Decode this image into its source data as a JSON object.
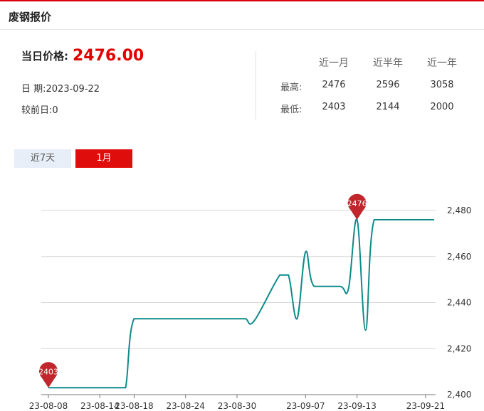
{
  "header": {
    "title": "废钢报价"
  },
  "current": {
    "price_label": "当日价格:",
    "price_value": "2476.00",
    "date_label": "日 期:",
    "date_value": "2023-09-22",
    "change_label": "较前日:",
    "change_value": "0"
  },
  "stats": {
    "columns": [
      "近一月",
      "近半年",
      "近一年"
    ],
    "rows": [
      {
        "label": "最高:",
        "values": [
          "2476",
          "2596",
          "3058"
        ]
      },
      {
        "label": "最低:",
        "values": [
          "2403",
          "2144",
          "2000"
        ]
      }
    ]
  },
  "tabs": [
    {
      "label": "近7天",
      "active": false
    },
    {
      "label": "1月",
      "active": true
    }
  ],
  "colors": {
    "accent": "#e00d0d",
    "line": "#0e8a8a",
    "pin": "#c0262c"
  },
  "chart_data": {
    "type": "line",
    "title": "",
    "xlabel": "",
    "ylabel": "",
    "ylim": [
      2400,
      2480
    ],
    "yticks": [
      2400,
      2420,
      2440,
      2460,
      2480
    ],
    "ytick_labels": [
      "2,400",
      "2,420",
      "2,440",
      "2,460",
      "2,480"
    ],
    "xticks": [
      "23-08-08",
      "23-08-14",
      "23-08-18",
      "23-08-24",
      "23-08-30",
      "23-09-07",
      "23-09-13",
      "23-09-21"
    ],
    "grid": true,
    "series": [
      {
        "x": [
          "23-08-08",
          "23-08-09",
          "23-08-10",
          "23-08-11",
          "23-08-14",
          "23-08-15",
          "23-08-16",
          "23-08-17",
          "23-08-18",
          "23-08-21",
          "23-08-22",
          "23-08-23",
          "23-08-24",
          "23-08-25",
          "23-08-28",
          "23-08-29",
          "23-08-30",
          "23-08-31",
          "23-09-01",
          "23-09-04",
          "23-09-05",
          "23-09-06",
          "23-09-07",
          "23-09-08",
          "23-09-11",
          "23-09-12",
          "23-09-13",
          "23-09-14",
          "23-09-15",
          "23-09-18",
          "23-09-19",
          "23-09-20",
          "23-09-21",
          "23-09-22"
        ],
        "values": [
          2403,
          2403,
          2403,
          2403,
          2403,
          2403,
          2403,
          2403,
          2433,
          2433,
          2433,
          2433,
          2433,
          2433,
          2433,
          2433,
          2433,
          2433,
          2432,
          2452,
          2452,
          2433,
          2462,
          2447,
          2447,
          2446,
          2476,
          2428,
          2476,
          2476,
          2476,
          2476,
          2476,
          2476
        ]
      }
    ],
    "markers": [
      {
        "label": "2403",
        "x": "23-08-08",
        "value": 2403
      },
      {
        "label": "2476",
        "x": "23-09-13",
        "value": 2476
      }
    ]
  }
}
